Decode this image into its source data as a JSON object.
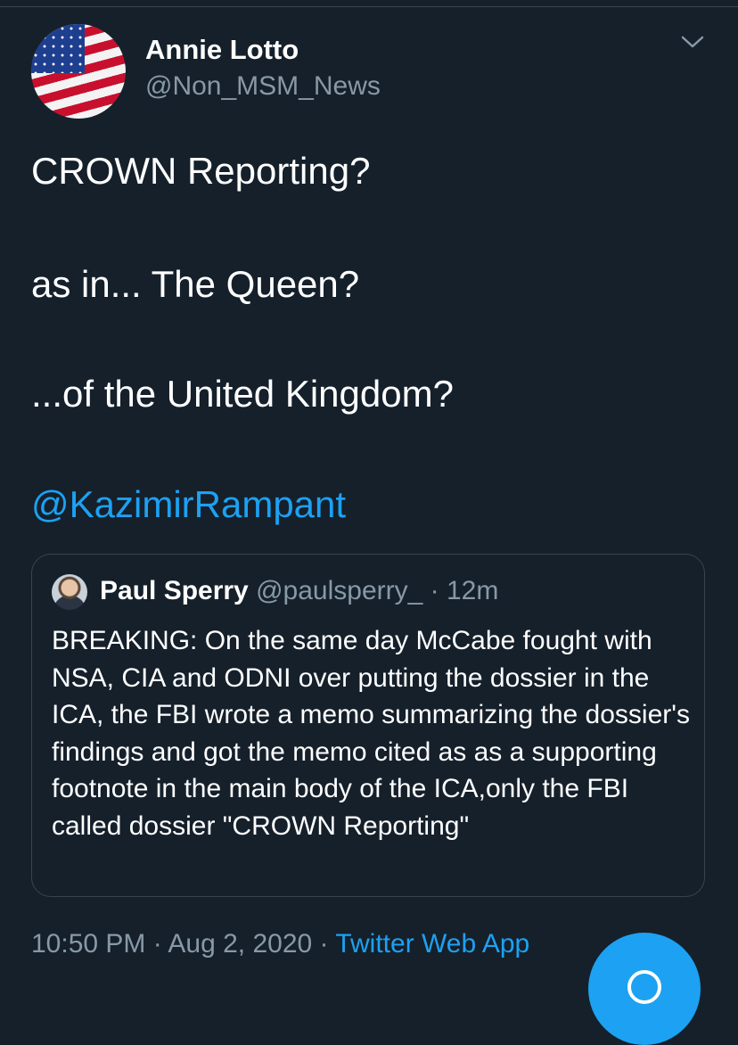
{
  "author": {
    "name": "Annie Lotto",
    "handle": "@Non_MSM_News",
    "avatar_icon": "us-flag-avatar"
  },
  "tweet": {
    "lines": [
      "CROWN Reporting?",
      "as in... The Queen?",
      "...of the United Kingdom?"
    ],
    "mention": "@KazimirRampant"
  },
  "quoted_tweet": {
    "name": "Paul Sperry",
    "handle": "@paulsperry_",
    "time": "· 12m",
    "text": "BREAKING: On the same day McCabe fought with NSA, CIA and ODNI over putting the dossier in the ICA, the FBI wrote a memo summarizing the dossier's findings and got the memo cited as as a supporting footnote in the main body of the ICA,only the FBI called dossier \"CROWN Reporting\""
  },
  "meta": {
    "timestamp": "10:50 PM · Aug 2, 2020 · ",
    "source": "Twitter Web App"
  },
  "fab": {
    "icon": "compose-icon"
  },
  "colors": {
    "background": "#15202b",
    "accent": "#1da1f2",
    "secondary_text": "#8899a6",
    "border": "#38444d"
  }
}
